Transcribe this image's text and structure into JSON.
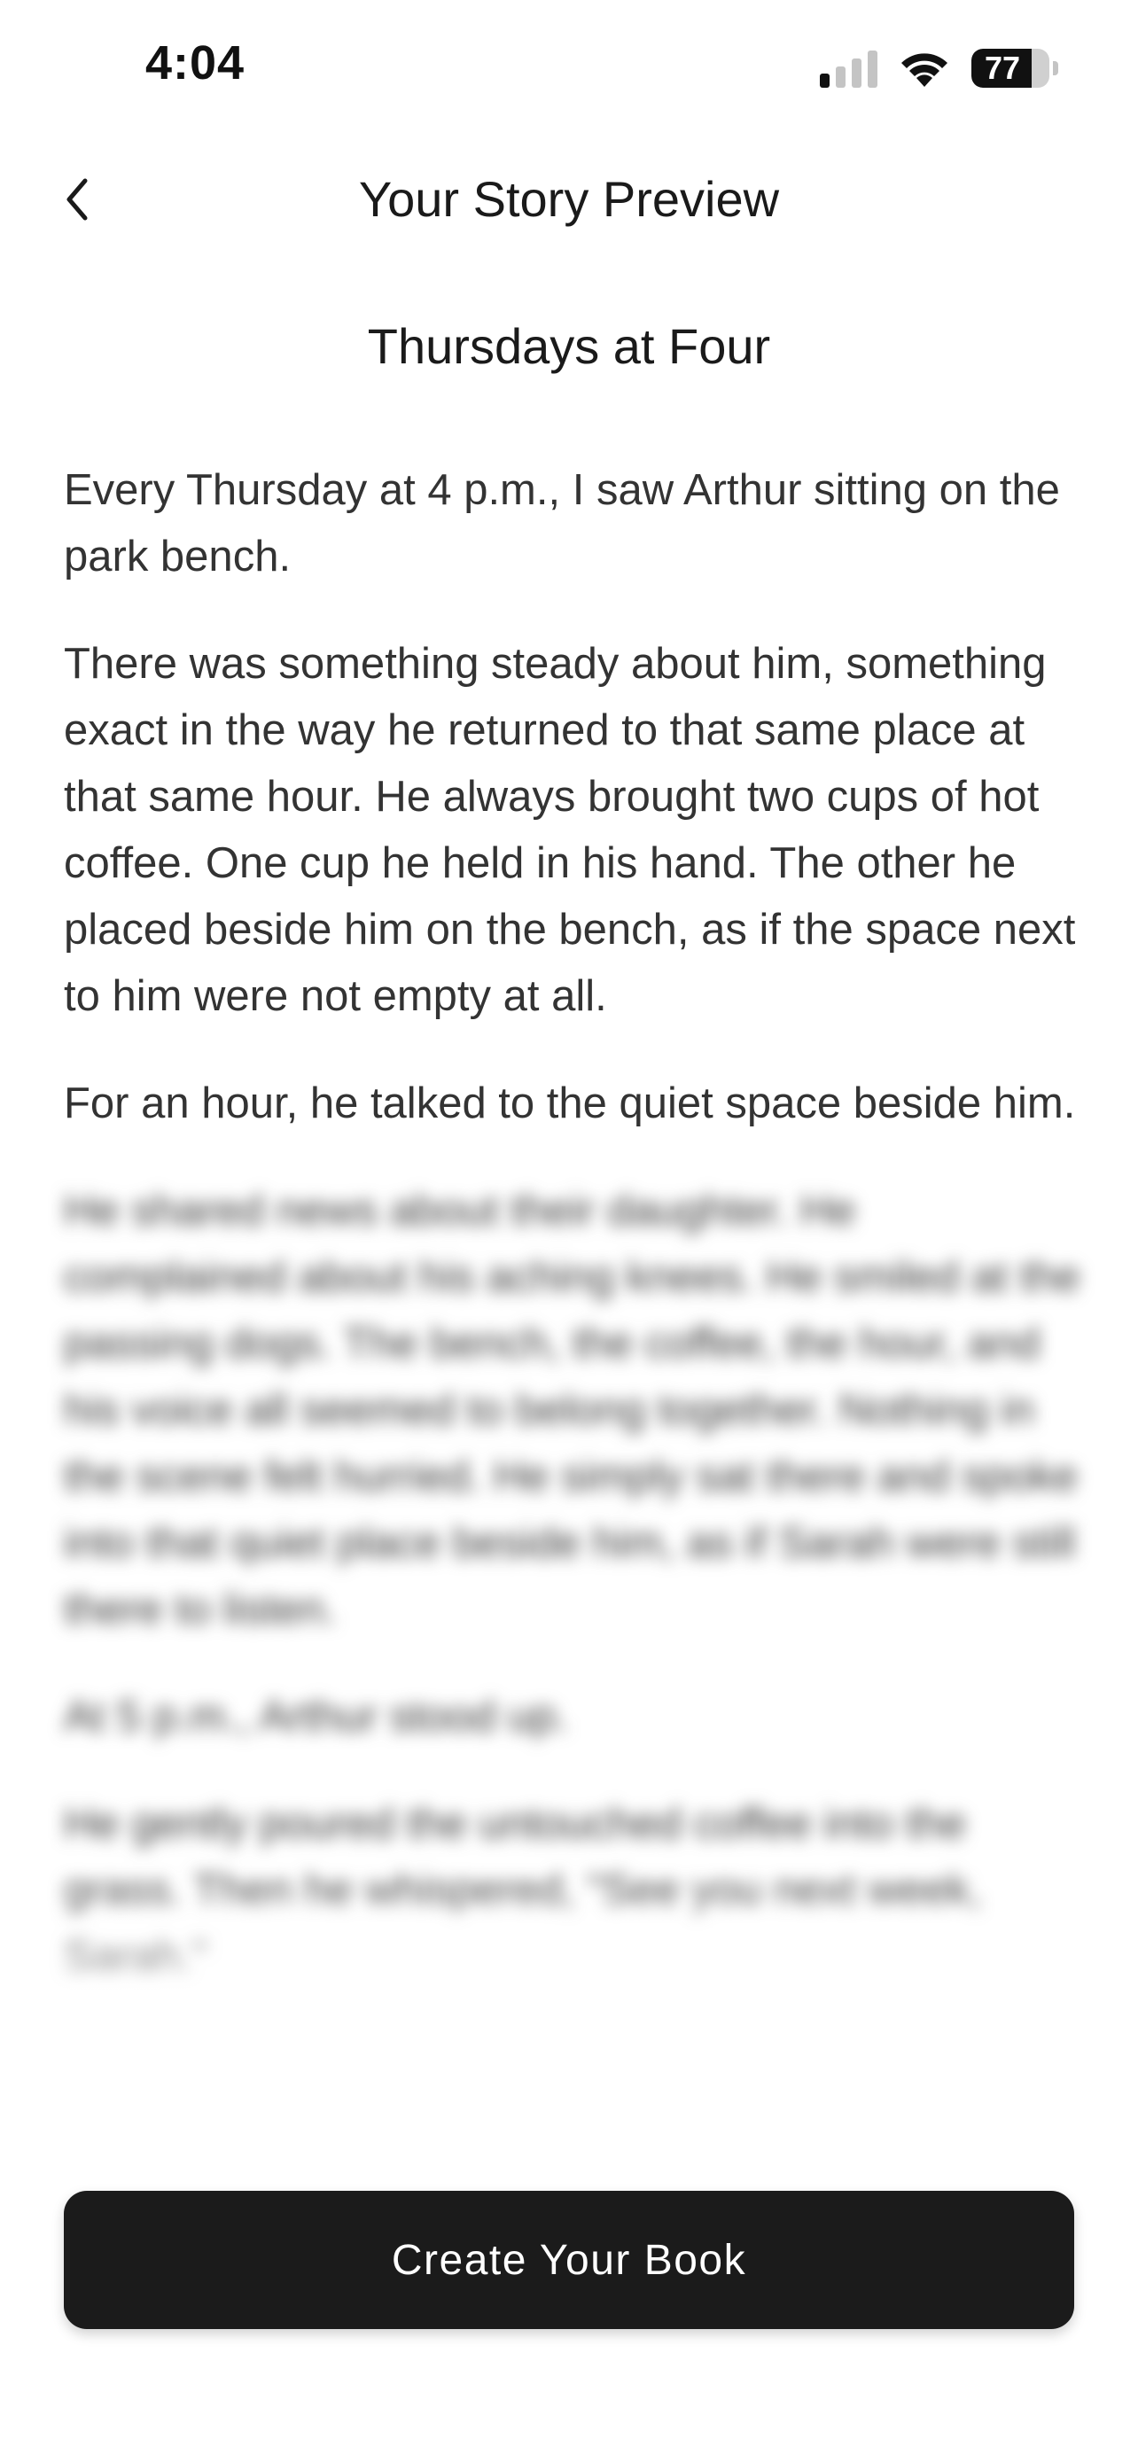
{
  "status_bar": {
    "time": "4:04",
    "battery_percent": 77,
    "battery_label": "77",
    "signal_bars_active": 1,
    "signal_bars_total": 4,
    "icons": [
      "signal-icon",
      "wifi-icon",
      "battery-icon"
    ]
  },
  "header": {
    "back_icon": "chevron-left-icon",
    "title": "Your Story Preview"
  },
  "story": {
    "title": "Thursdays at Four",
    "paragraphs": [
      "Every Thursday at 4 p.m., I saw Arthur sitting on the park bench.",
      "There was something steady about him, something exact in the way he returned to that same place at that same hour. He always brought two cups of hot coffee. One cup he held in his hand. The other he placed beside him on the bench, as if the space next to him were not empty at all.",
      "For an hour, he talked to the quiet space beside him."
    ],
    "blurred_paragraphs": [
      "He shared news about their daughter. He complained about his aching knees. He smiled at the passing dogs. The bench, the coffee, the hour, and his voice all seemed to belong together. Nothing in the scene felt hurried. He simply sat there and spoke into that quiet place beside him, as if Sarah were still there to listen.",
      "At 5 p.m., Arthur stood up.",
      "He gently poured the untouched coffee into the grass. Then he whispered, \"See you next week, Sarah.\""
    ]
  },
  "cta": {
    "label": "Create Your Book"
  },
  "colors": {
    "cta_background": "#1b1b1b",
    "cta_text": "#ffffff",
    "body_text": "#333333",
    "page_background": "#ffffff"
  }
}
